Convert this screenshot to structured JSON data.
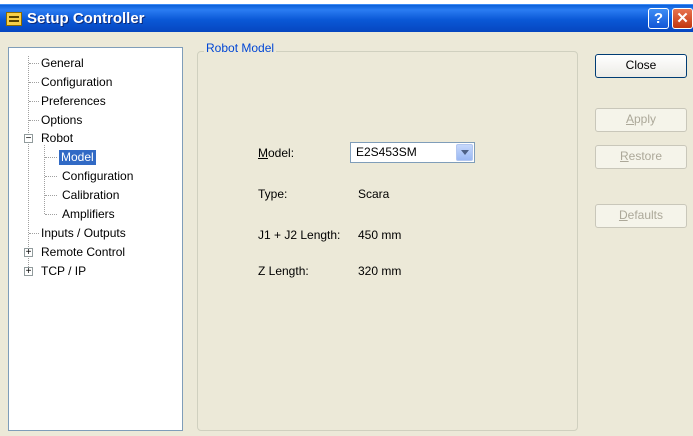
{
  "window": {
    "title": "Setup Controller",
    "help_label": "?",
    "close_label": "✕"
  },
  "tree": {
    "items": [
      {
        "label": "General"
      },
      {
        "label": "Configuration"
      },
      {
        "label": "Preferences"
      },
      {
        "label": "Options"
      },
      {
        "label": "Robot",
        "expander": "−"
      },
      {
        "label": "Model",
        "selected": true
      },
      {
        "label": "Configuration"
      },
      {
        "label": "Calibration"
      },
      {
        "label": "Amplifiers"
      },
      {
        "label": "Inputs / Outputs"
      },
      {
        "label": "Remote Control",
        "expander": "+"
      },
      {
        "label": "TCP / IP",
        "expander": "+"
      }
    ]
  },
  "panel": {
    "group_title": "Robot Model",
    "model_label": "Model:",
    "model_value": "E2S453SM",
    "type_label": "Type:",
    "type_value": "Scara",
    "j1j2_label": "J1 + J2 Length:",
    "j1j2_value": "450 mm",
    "z_label": "Z Length:",
    "z_value": "320 mm"
  },
  "buttons": {
    "close": "Close",
    "apply": "Apply",
    "restore": "Restore",
    "defaults": "Defaults"
  }
}
